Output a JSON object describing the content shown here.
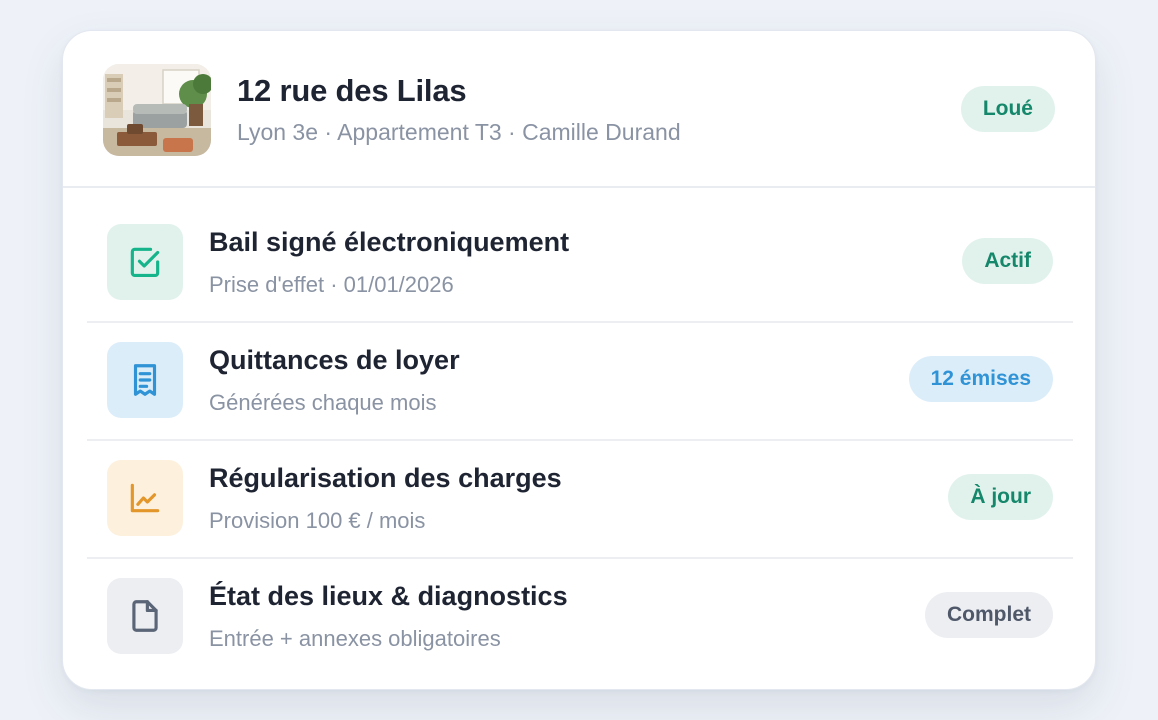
{
  "property": {
    "address": "12 rue des Lilas",
    "subtitle": "Lyon 3e · Appartement T3 · Camille Durand",
    "status": "Loué",
    "photo": "apartment-living-room-photo"
  },
  "items": [
    {
      "title": "Bail signé électroniquement",
      "description": "Prise d'effet · 01/01/2026",
      "badge": "Actif",
      "icon": "check-square-icon",
      "accent": "#15b48a"
    },
    {
      "title": "Quittances de loyer",
      "description": "Générées chaque mois",
      "badge": "12 émises",
      "icon": "receipt-icon",
      "accent": "#2f93d6"
    },
    {
      "title": "Régularisation des charges",
      "description": "Provision 100 € / mois",
      "badge": "À jour",
      "icon": "chart-line-icon",
      "accent": "#e3962a"
    },
    {
      "title": "État des lieux & diagnostics",
      "description": "Entrée + annexes obligatoires",
      "badge": "Complet",
      "icon": "document-icon",
      "accent": "#5b6578"
    }
  ]
}
